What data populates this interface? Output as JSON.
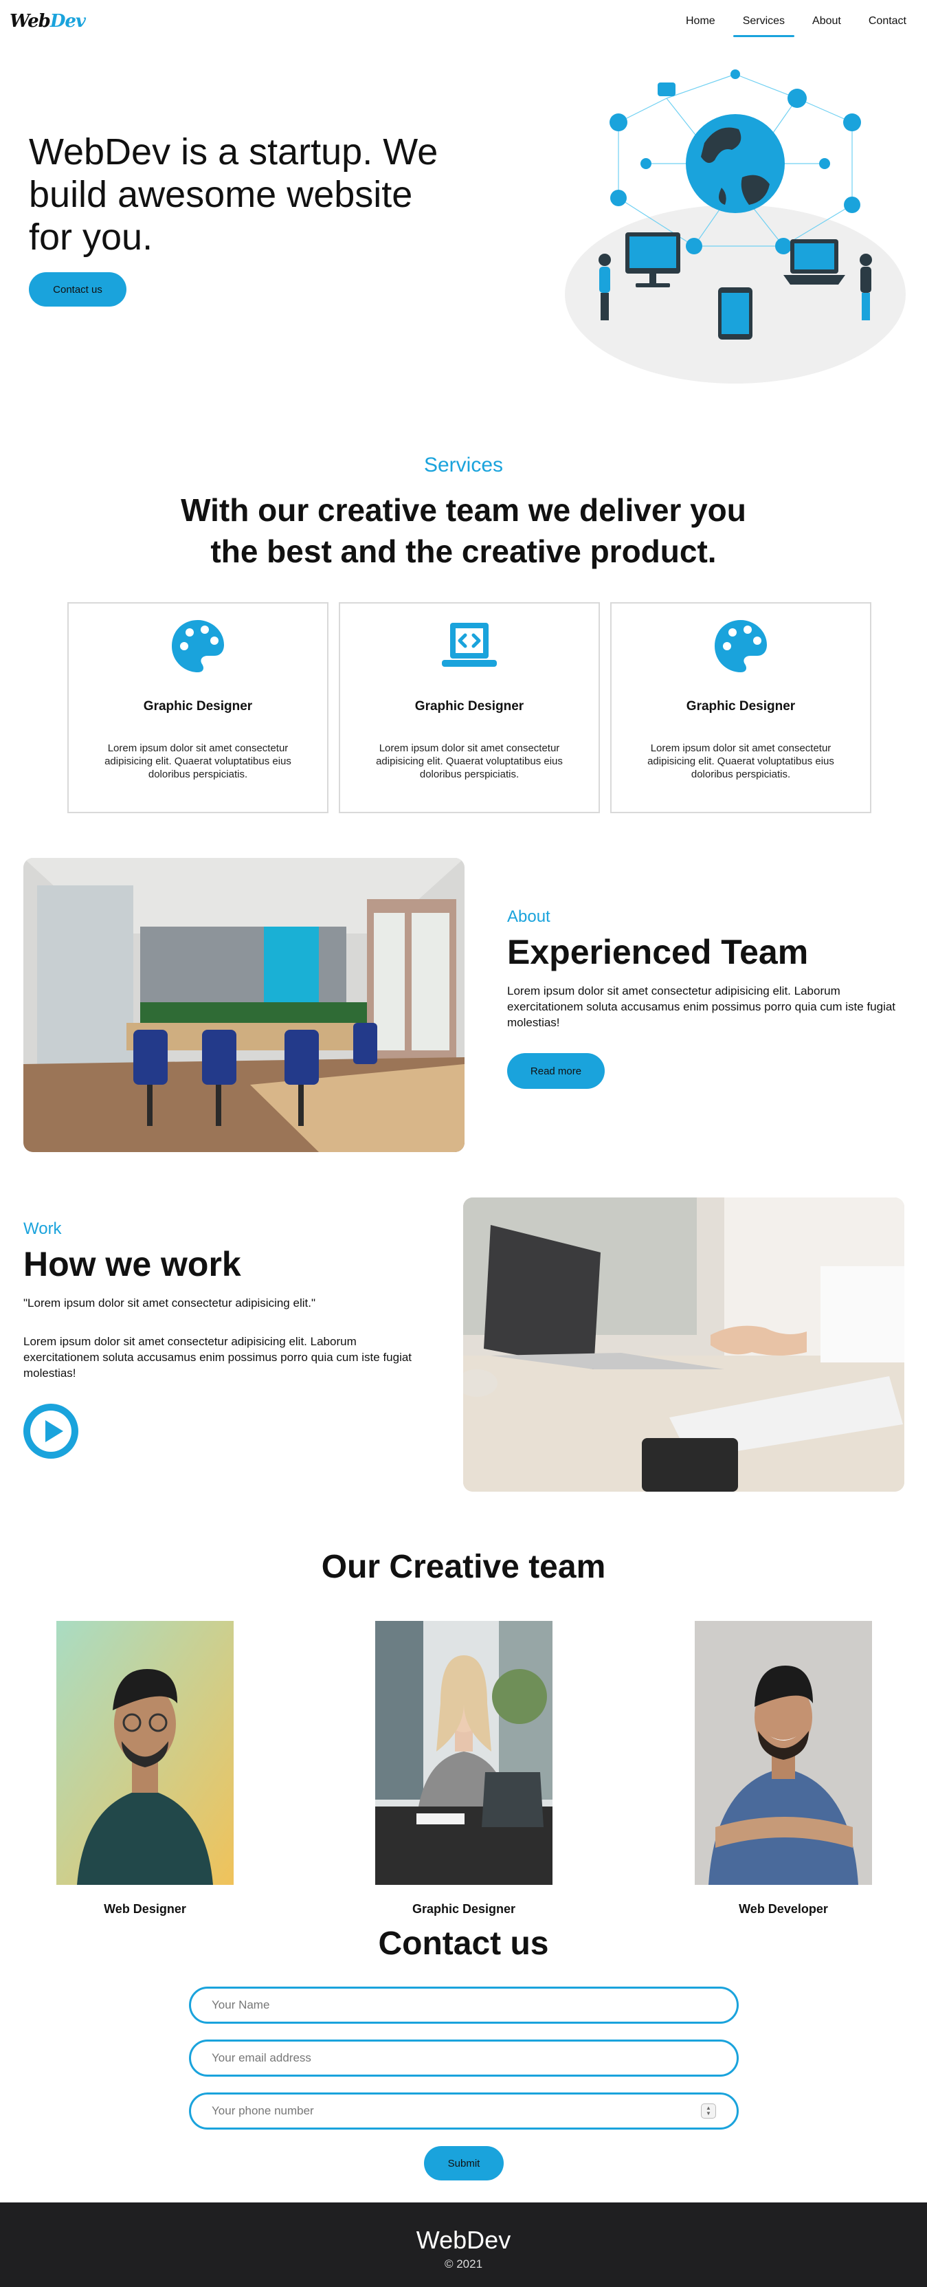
{
  "brand": {
    "part1": "Web",
    "part2": "Dev"
  },
  "nav": {
    "items": [
      "Home",
      "Services",
      "About",
      "Contact"
    ],
    "active": "Services"
  },
  "hero": {
    "title": "WebDev is a startup. We build awesome website for you.",
    "button": "Contact us"
  },
  "services": {
    "eyebrow": "Services",
    "title_line1": "With our creative team we deliver you",
    "title_line2": "the best and the creative product.",
    "cards": [
      {
        "icon": "palette-icon",
        "title": "Graphic Designer",
        "text": "Lorem ipsum dolor sit amet consectetur adipisicing elit. Quaerat voluptatibus eius doloribus perspiciatis."
      },
      {
        "icon": "laptop-code-icon",
        "title": "Graphic Designer",
        "text": "Lorem ipsum dolor sit amet consectetur adipisicing elit. Quaerat voluptatibus eius doloribus perspiciatis."
      },
      {
        "icon": "palette-icon",
        "title": "Graphic Designer",
        "text": "Lorem ipsum dolor sit amet consectetur adipisicing elit. Quaerat voluptatibus eius doloribus perspiciatis."
      }
    ]
  },
  "about": {
    "eyebrow": "About",
    "title": "Experienced Team",
    "text": "Lorem ipsum dolor sit amet consectetur adipisicing elit. Laborum exercitationem soluta accusamus enim possimus porro quia cum iste fugiat molestias!",
    "button": "Read more"
  },
  "work": {
    "eyebrow": "Work",
    "title": "How we work",
    "quote": "\"Lorem ipsum dolor sit amet consectetur adipisicing elit.\"",
    "text": "Lorem ipsum dolor sit amet consectetur adipisicing elit. Laborum exercitationem soluta accusamus enim possimus porro quia cum iste fugiat molestias!"
  },
  "team": {
    "title": "Our Creative team",
    "members": [
      {
        "role": "Web Designer"
      },
      {
        "role": "Graphic Designer"
      },
      {
        "role": "Web Developer"
      }
    ]
  },
  "contact": {
    "title": "Contact us",
    "name_placeholder": "Your Name",
    "email_placeholder": "Your email address",
    "phone_placeholder": "Your phone number",
    "submit": "Submit"
  },
  "footer": {
    "brand": "WebDev",
    "copyright": "© 2021"
  },
  "colors": {
    "accent": "#1aa3dc",
    "footer_bg": "#1f1f21"
  }
}
